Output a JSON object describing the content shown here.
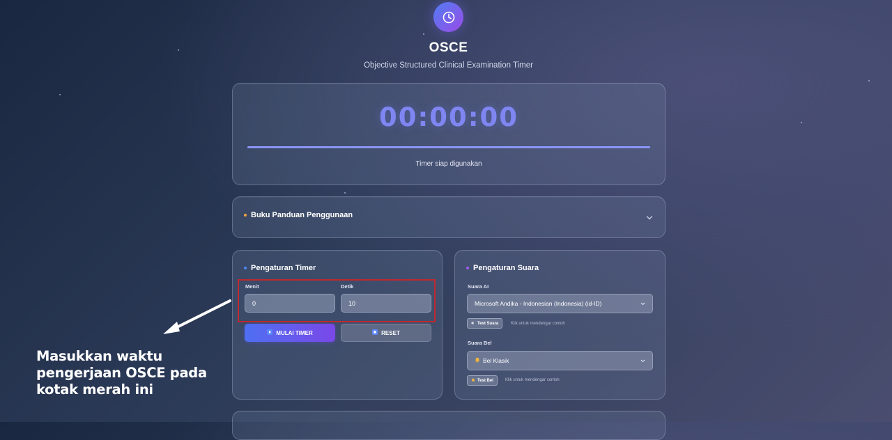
{
  "header": {
    "title": "OSCE",
    "subtitle": "Objective Structured Clinical Examination Timer"
  },
  "timer": {
    "display": "00:00:00",
    "progress": 1.0,
    "status": "Timer siap digunakan"
  },
  "guide": {
    "title": "Buku Panduan Penggunaan"
  },
  "timer_settings": {
    "title": "Pengaturan Timer",
    "minutes_label": "Menit",
    "minutes_value": "0",
    "seconds_label": "Detik",
    "seconds_value": "10",
    "start_label": "MULAI TIMER",
    "reset_label": "RESET"
  },
  "sound_settings": {
    "title": "Pengaturan Suara",
    "ai_voice_label": "Suara AI",
    "ai_voice_value": "Microsoft Andika - Indonesian (Indonesia) (id-ID)",
    "test_voice_label": "Test Suara",
    "test_voice_hint": "Klik untuk mendengar contoh",
    "bell_label": "Suara Bel",
    "bell_value": "Bel Klasik",
    "test_bell_label": "Test Bel",
    "test_bell_hint": "Klik untuk mendengar contoh"
  },
  "annotation": {
    "line1": "Masukkan waktu",
    "line2": "pengerjaan OSCE pada",
    "line3": "kotak merah ini"
  },
  "colors": {
    "accent": "#7f86f2",
    "annotation_box": "#c0282f",
    "start_gradient_from": "#4e6ff2",
    "start_gradient_to": "#7a48e8"
  },
  "icons": {
    "logo": "clock-icon",
    "guide_toggle": "chevron-down-icon",
    "start": "play-icon",
    "reset": "stop-icon",
    "select": "chevron-down-icon",
    "bell": "bell-icon",
    "speaker": "speaker-icon",
    "annotation": "arrow-icon"
  }
}
